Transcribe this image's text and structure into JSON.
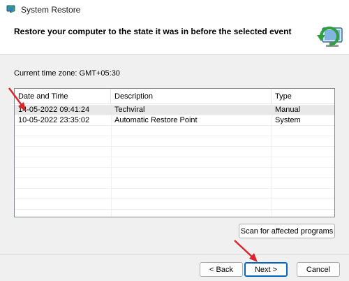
{
  "window": {
    "title": "System Restore",
    "header_text": "Restore your computer to the state it was in before the selected event"
  },
  "timezone": "Current time zone: GMT+05:30",
  "table": {
    "columns": [
      "Date and Time",
      "Description",
      "Type"
    ],
    "rows": [
      {
        "date": "14-05-2022 09:41:24",
        "description": "Techviral",
        "type": "Manual"
      },
      {
        "date": "10-05-2022 23:35:02",
        "description": "Automatic Restore Point",
        "type": "System"
      }
    ]
  },
  "buttons": {
    "scan": "Scan for affected programs",
    "back": "< Back",
    "next": "Next >",
    "cancel": "Cancel"
  },
  "colors": {
    "annotation_arrow": "#d9262c",
    "accent": "#0067c0"
  },
  "icons": {
    "app": "system-restore-icon",
    "header": "restore-monitor-icon"
  }
}
